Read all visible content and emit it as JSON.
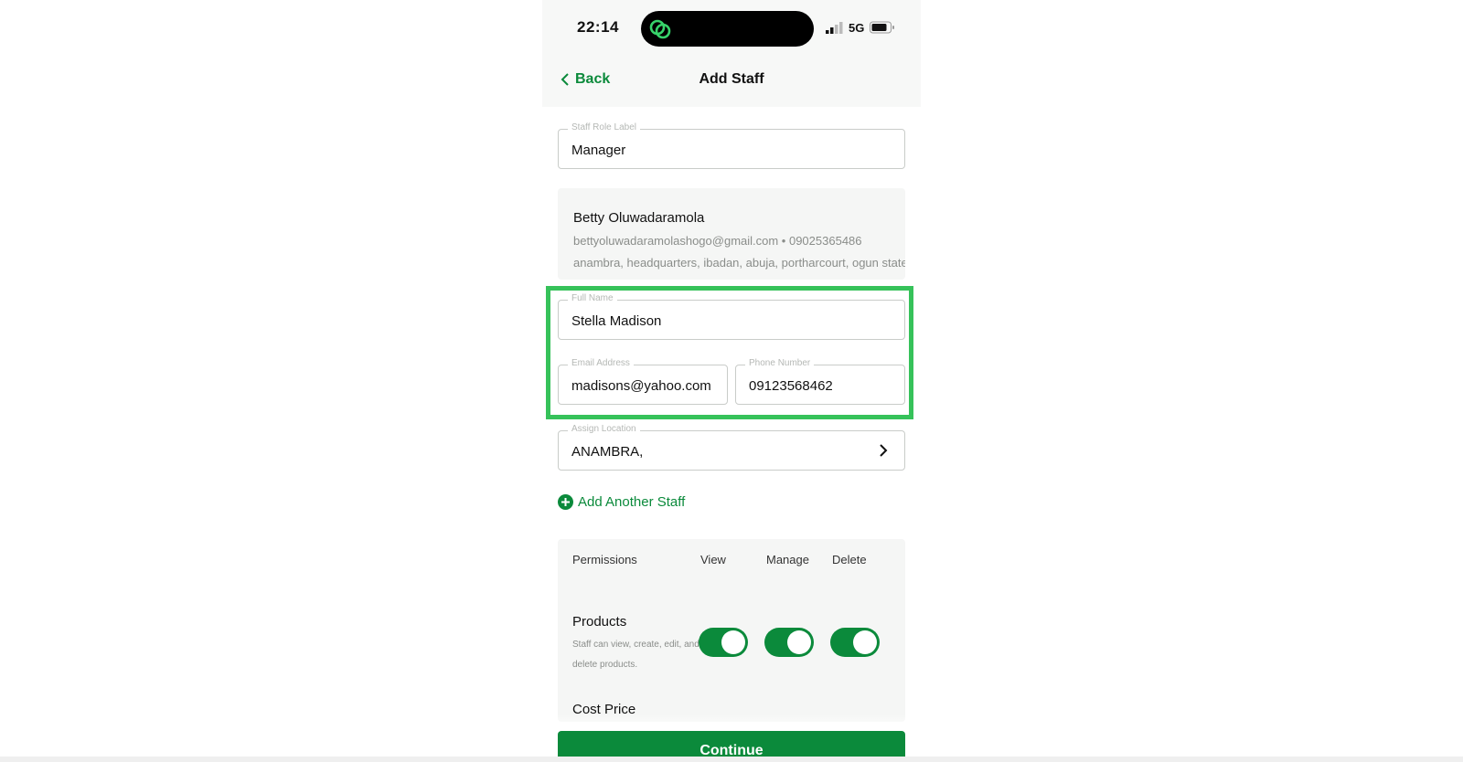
{
  "status_bar": {
    "time": "22:14",
    "network": "5G",
    "icons": [
      "app-logo-icon",
      "signal-icon",
      "battery-icon"
    ]
  },
  "header": {
    "back_label": "Back",
    "title": "Add Staff"
  },
  "role_field": {
    "label": "Staff Role Label",
    "value": "Manager"
  },
  "existing_staff": {
    "name": "Betty Oluwadaramola",
    "contact": "bettyoluwadaramolashogo@gmail.com • 09025365486",
    "locations": "anambra, headquarters, ibadan, abuja, portharcourt, ogun state"
  },
  "new_staff": {
    "full_name_label": "Full Name",
    "full_name_value": "Stella Madison",
    "email_label": "Email Address",
    "email_value": "madisons@yahoo.com",
    "phone_label": "Phone Number",
    "phone_value": "09123568462"
  },
  "location_field": {
    "label": "Assign Location",
    "value": "ANAMBRA,"
  },
  "add_another_label": "Add Another Staff",
  "permissions": {
    "header": "Permissions",
    "columns": [
      "View",
      "Manage",
      "Delete"
    ],
    "rows": [
      {
        "name": "Products",
        "description": "Staff can view, create, edit, and delete products.",
        "view": true,
        "manage": true,
        "delete": true
      },
      {
        "name": "Cost Price"
      }
    ]
  },
  "continue_label": "Continue",
  "colors": {
    "accent": "#0b8a3b",
    "highlight": "#36c25a"
  }
}
